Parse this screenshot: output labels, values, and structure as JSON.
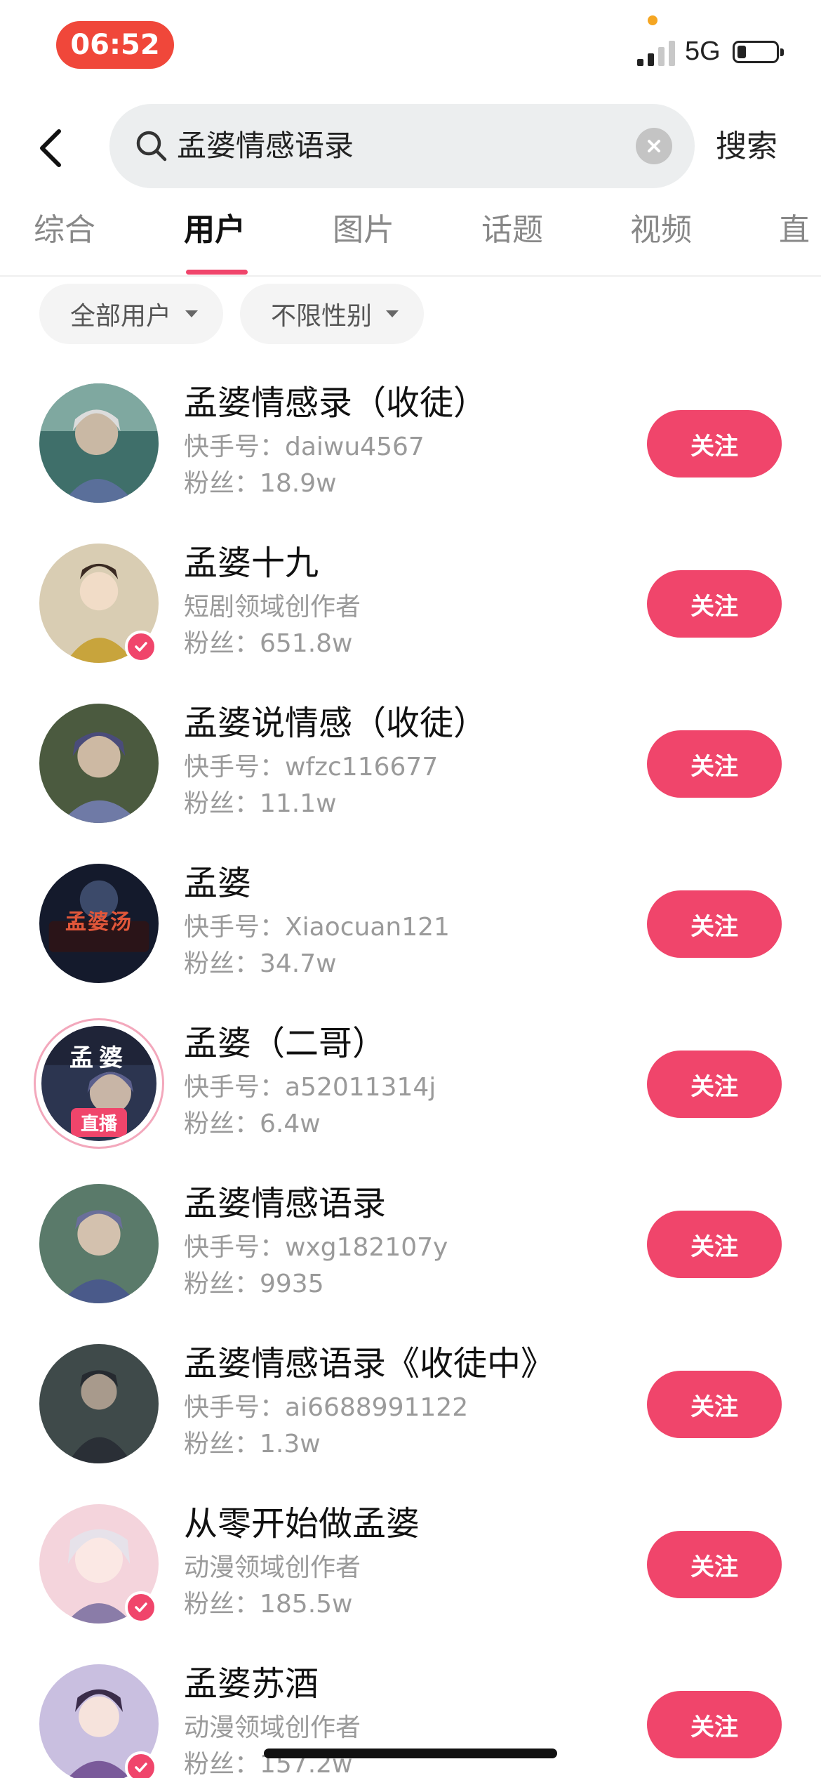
{
  "status_bar": {
    "time": "06:52",
    "network": "5G",
    "icons": [
      "signal-icon",
      "battery-icon"
    ]
  },
  "search": {
    "query": "孟婆情感语录",
    "submit_label": "搜索",
    "icons": [
      "back-arrow-icon",
      "search-icon",
      "clear-icon"
    ]
  },
  "tabs": [
    {
      "label": "综合"
    },
    {
      "label": "用户",
      "active": true
    },
    {
      "label": "图片"
    },
    {
      "label": "话题"
    },
    {
      "label": "视频"
    },
    {
      "label": "直"
    }
  ],
  "filters": [
    {
      "label": "全部用户"
    },
    {
      "label": "不限性别"
    }
  ],
  "users": [
    {
      "name": "孟婆情感录（收徒）",
      "sub": "快手号：daiwu4567",
      "fans": "粉丝：18.9w",
      "follow_label": "关注",
      "verified": false,
      "live": false
    },
    {
      "name": "孟婆十九",
      "sub": "短剧领域创作者",
      "fans": "粉丝：651.8w",
      "follow_label": "关注",
      "verified": true,
      "live": false
    },
    {
      "name": "孟婆说情感（收徒）",
      "sub": "快手号：wfzc116677",
      "fans": "粉丝：11.1w",
      "follow_label": "关注",
      "verified": false,
      "live": false
    },
    {
      "name": "孟婆",
      "sub": "快手号：Xiaocuan121",
      "fans": "粉丝：34.7w",
      "follow_label": "关注",
      "verified": false,
      "live": false,
      "avatar_text": "孟婆汤"
    },
    {
      "name": "孟婆（二哥）",
      "sub": "快手号：a52011314j",
      "fans": "粉丝：6.4w",
      "follow_label": "关注",
      "verified": false,
      "live": true,
      "live_label": "直播",
      "avatar_text": "孟婆"
    },
    {
      "name": "孟婆情感语录",
      "sub": "快手号：wxg182107y",
      "fans": "粉丝：9935",
      "follow_label": "关注",
      "verified": false,
      "live": false
    },
    {
      "name": "孟婆情感语录《收徒中》",
      "sub": "快手号：ai6688991122",
      "fans": "粉丝：1.3w",
      "follow_label": "关注",
      "verified": false,
      "live": false
    },
    {
      "name": "从零开始做孟婆",
      "sub": "动漫领域创作者",
      "fans": "粉丝：185.5w",
      "follow_label": "关注",
      "verified": true,
      "live": false
    },
    {
      "name": "孟婆苏酒",
      "sub": "动漫领域创作者",
      "fans": "粉丝：157.2w",
      "follow_label": "关注",
      "verified": true,
      "live": false
    }
  ],
  "colors": {
    "accent": "#f0456b",
    "time_pill": "#f0473a",
    "muted_text": "#9a9a9a"
  }
}
